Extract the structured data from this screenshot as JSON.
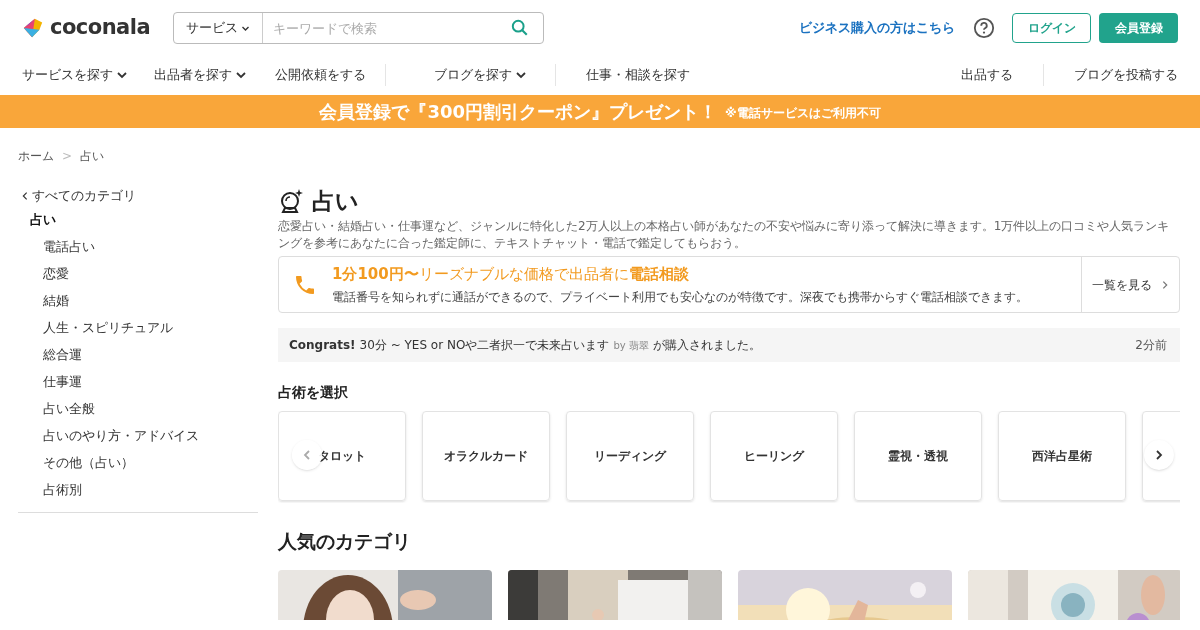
{
  "header": {
    "logo_text": "coconala",
    "search": {
      "scope": "サービス",
      "placeholder": "キーワードで検索"
    },
    "business_link": "ビジネス購入の方はこちら",
    "login": "ログイン",
    "signup": "会員登録"
  },
  "nav": {
    "left": [
      {
        "label": "サービスを探す",
        "dropdown": true
      },
      {
        "label": "出品者を探す",
        "dropdown": true
      },
      {
        "label": "公開依頼をする",
        "dropdown": false
      },
      {
        "label": "ブログを探す",
        "dropdown": true
      },
      {
        "label": "仕事・相談を探す",
        "dropdown": false
      }
    ],
    "right": [
      "出品する",
      "ブログを投稿する"
    ]
  },
  "banner": {
    "text": "会員登録で『300円割引クーポン』プレゼント！",
    "note": "※電話サービスはご利用不可"
  },
  "breadcrumb": {
    "separator": ">",
    "items": [
      "ホーム",
      "占い"
    ]
  },
  "sidebar": {
    "back": "すべてのカテゴリ",
    "items": [
      {
        "label": "占い",
        "selected": true,
        "children": [
          {
            "label": "電話占い",
            "selected": false
          },
          {
            "label": "恋愛",
            "selected": false
          },
          {
            "label": "結婚",
            "selected": false
          },
          {
            "label": "人生・スピリチュアル",
            "selected": false
          },
          {
            "label": "総合運",
            "selected": false
          },
          {
            "label": "仕事運",
            "selected": false
          },
          {
            "label": "占い全般",
            "selected": false
          },
          {
            "label": "占いのやり方・アドバイス",
            "selected": false
          },
          {
            "label": "その他（占い）",
            "selected": false
          },
          {
            "label": "占術別",
            "selected": false
          }
        ]
      }
    ]
  },
  "main": {
    "title": "占い",
    "description": "恋愛占い・結婚占い・仕事運など、ジャンルに特化した2万人以上の本格占い師があなたの不安や悩みに寄り添って解決に導きます。1万件以上の口コミや人気ランキングを参考にあなたに合った鑑定師に、テキストチャット・電話で鑑定してもらおう。",
    "phone_card": {
      "title": "**1分100円〜**リーズナブルな価格で出品者に**電話相談**",
      "body": "電話番号を知られずに通話ができるので、プライベート利用でも安心なのが特徴です。深夜でも携帯からすぐ電話相談できます。",
      "link": "一覧を見る"
    },
    "purchase_notice": {
      "lead": "Congrats!",
      "service": "30分 ~ YES or NOや二者択一で未来占います",
      "buyer": "by 翡翠",
      "suffix": "が購入されました。",
      "time": "2分前"
    },
    "methods": {
      "heading": "占術を選択",
      "items": [
        "タロット",
        "オラクルカード",
        "リーディング",
        "ヒーリング",
        "霊視・透視",
        "西洋占星術"
      ]
    },
    "popular": {
      "heading": "人気のカテゴリ"
    }
  }
}
